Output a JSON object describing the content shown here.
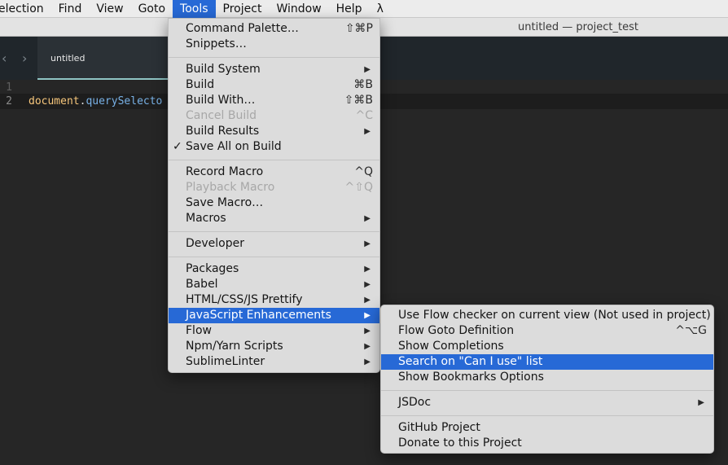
{
  "menubar": {
    "items": [
      "election",
      "Find",
      "View",
      "Goto",
      "Tools",
      "Project",
      "Window",
      "Help",
      "λ"
    ],
    "active_index": 4
  },
  "window": {
    "title": "untitled — project_test"
  },
  "tabs": {
    "back_icon": "‹",
    "forward_icon": "›",
    "active_label": "untitled"
  },
  "editor": {
    "lines": [
      {
        "number": "1",
        "code": ""
      },
      {
        "number": "2",
        "obj": "document",
        "dot": ".",
        "fn": "querySelecto"
      }
    ]
  },
  "tools_menu": {
    "items": [
      {
        "label": "Command Palette…",
        "shortcut": "⇧⌘P"
      },
      {
        "label": "Snippets…"
      },
      {
        "label": "Build System",
        "submenu": true
      },
      {
        "label": "Build",
        "shortcut": "⌘B"
      },
      {
        "label": "Build With…",
        "shortcut": "⇧⌘B"
      },
      {
        "label": "Cancel Build",
        "shortcut": "^C",
        "disabled": true
      },
      {
        "label": "Build Results",
        "submenu": true
      },
      {
        "label": "Save All on Build",
        "checked": true,
        "check": "✓"
      },
      {
        "label": "Record Macro",
        "shortcut": "^Q"
      },
      {
        "label": "Playback Macro",
        "shortcut": "^⇧Q",
        "disabled": true
      },
      {
        "label": "Save Macro…"
      },
      {
        "label": "Macros",
        "submenu": true
      },
      {
        "label": "Developer",
        "submenu": true
      },
      {
        "label": "Packages",
        "submenu": true
      },
      {
        "label": "Babel",
        "submenu": true
      },
      {
        "label": "HTML/CSS/JS Prettify",
        "submenu": true
      },
      {
        "label": "JavaScript Enhancements",
        "submenu": true,
        "selected": true
      },
      {
        "label": "Flow",
        "submenu": true
      },
      {
        "label": "Npm/Yarn Scripts",
        "submenu": true
      },
      {
        "label": "SublimeLinter",
        "submenu": true
      }
    ],
    "submenu_arrow": "▶"
  },
  "js_menu": {
    "items": [
      {
        "label": "Use Flow checker on current view (Not used in project)"
      },
      {
        "label": "Flow Goto Definition",
        "shortcut": "^⌥G"
      },
      {
        "label": "Show Completions"
      },
      {
        "label": "Search on \"Can I use\" list",
        "selected": true
      },
      {
        "label": "Show Bookmarks Options"
      },
      {
        "label": "JSDoc",
        "submenu": true
      },
      {
        "label": "GitHub Project"
      },
      {
        "label": "Donate to this Project"
      }
    ]
  },
  "colors": {
    "selection": "#2769d6",
    "menu_bg": "#dcdcdc",
    "editor_bg": "#262626",
    "tab_accent": "#8ec4c4"
  }
}
